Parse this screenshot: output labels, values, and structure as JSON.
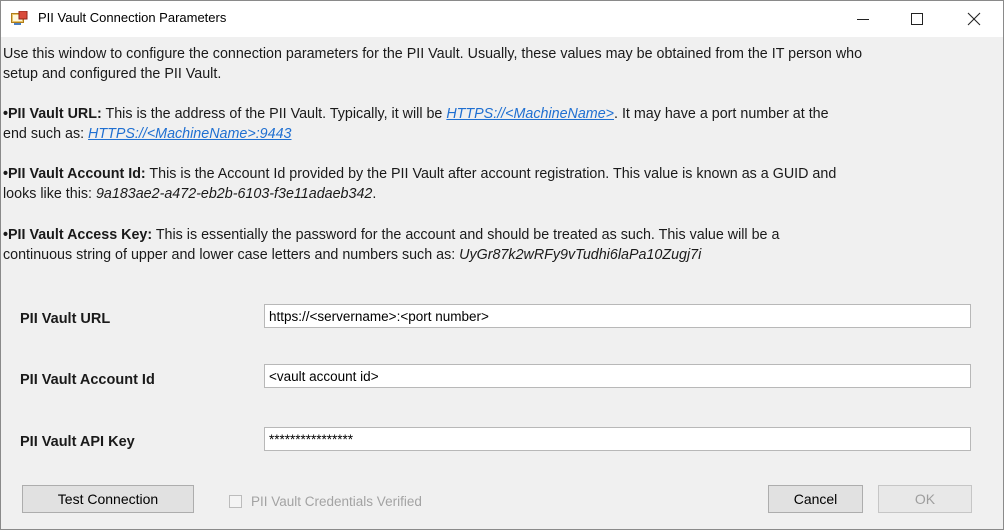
{
  "window": {
    "title": "PII Vault Connection Parameters",
    "minimize_glyph": "—",
    "maximize_glyph": "☐",
    "close_glyph": "✕"
  },
  "intro": {
    "line1": "Use this window to configure the connection parameters for the PII Vault. Usually, these values may be obtained from the IT person who",
    "line2": "setup and configured the PII Vault."
  },
  "help_url": {
    "label": "•PII Vault URL:",
    "text1": " This is the address of the PII Vault. Typically, it will be ",
    "link1": "HTTPS://<MachineName>",
    "text2": ".  It may have a port number at the",
    "text3": "end such as: ",
    "link2": "HTTPS://<MachineName>:9443"
  },
  "help_account": {
    "label": "•PII Vault Account Id:",
    "text1": " This is the Account Id provided by the PII Vault after account registration. This value is known as a GUID and",
    "text2": "looks like this: ",
    "example": "9a183ae2-a472-eb2b-6103-f3e11adaeb342",
    "text3": "."
  },
  "help_key": {
    "label": "•PII Vault Access Key:",
    "text1": " This is essentially the password for the account and should be treated as such. This value will be a",
    "text2": "continuous string of upper and lower case letters and numbers such as:  ",
    "example": "UyGr87k2wRFy9vTudhi6laPa10Zugj7i"
  },
  "form": {
    "url_label": "PII Vault URL",
    "url_value": "https://<servername>:<port number>",
    "account_label": "PII Vault Account Id",
    "account_value": "<vault account id>",
    "key_label": "PII Vault API Key",
    "key_value": "****************"
  },
  "footer": {
    "test_button": "Test Connection",
    "verified_label": "PII Vault Credentials Verified",
    "verified_checked": false,
    "cancel_button": "Cancel",
    "ok_button": "OK"
  },
  "colors": {
    "link": "#1f6fd1",
    "window_bg": "#f0f0f0",
    "disabled_text": "#a3a3a3"
  }
}
